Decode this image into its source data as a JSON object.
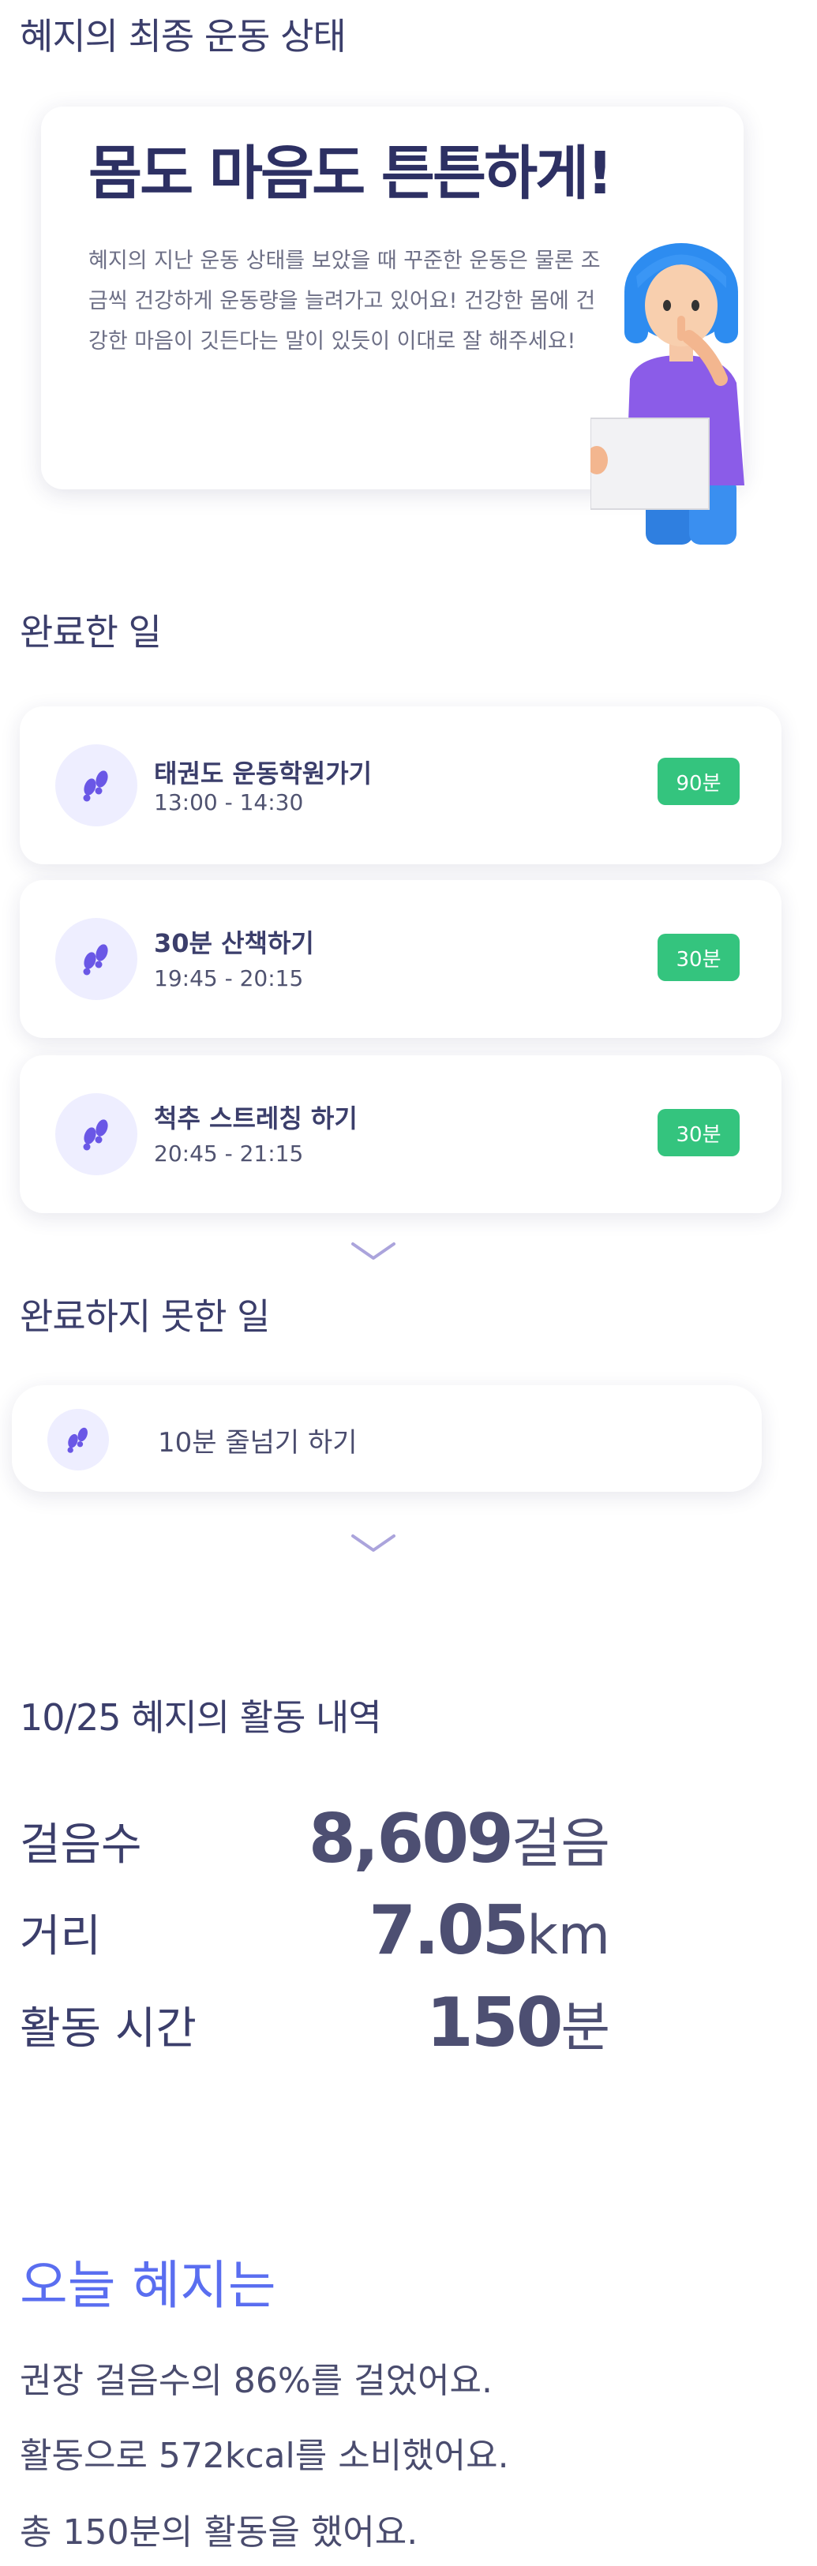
{
  "final_status": {
    "section_title": "혜지의 최종 운동 상태",
    "hero_title": "몸도 마음도 튼튼하게!",
    "hero_body": "혜지의 지난 운동 상태를 보았을 때 꾸준한 운동은 물론 조금씩 건강하게 운동량을 늘려가고 있어요! 건강한 몸에 건강한 마음이 깃든다는 말이 있듯이 이대로 잘 해주세요!"
  },
  "completed": {
    "section_title": "완료한 일",
    "items": [
      {
        "title": "태권도 운동학원가기",
        "time": "13:00 - 14:30",
        "badge": "90분"
      },
      {
        "title": "30분 산책하기",
        "time": "19:45 - 20:15",
        "badge": "30분"
      },
      {
        "title": "척추 스트레칭 하기",
        "time": "20:45 - 21:15",
        "badge": "30분"
      }
    ],
    "expand_icon": "chevron-down-icon"
  },
  "not_completed": {
    "section_title": "완료하지 못한 일",
    "items": [
      {
        "title": "10분 줄넘기 하기"
      }
    ],
    "expand_icon": "chevron-down-icon"
  },
  "activity": {
    "section_title": "10/25 혜지의 활동 내역",
    "rows": [
      {
        "label": "걸음수",
        "value": "8,609",
        "unit": "걸음"
      },
      {
        "label": "거리",
        "value": "7.05",
        "unit": "km"
      },
      {
        "label": "활동 시간",
        "value": "150",
        "unit": "분"
      }
    ]
  },
  "today": {
    "title": "오늘 혜지는",
    "lines": [
      "권장 걸음수의 86%를 걸었어요.",
      "활동으로 572kcal를 소비했어요.",
      "총 150분의 활동을 했어요."
    ]
  },
  "colors": {
    "accent": "#5a6ef0",
    "badge_green": "#34c47e",
    "icon_bg": "#eeeeff",
    "text_dark": "#3b3e6b"
  },
  "icons": {
    "task": "footprints-icon"
  }
}
